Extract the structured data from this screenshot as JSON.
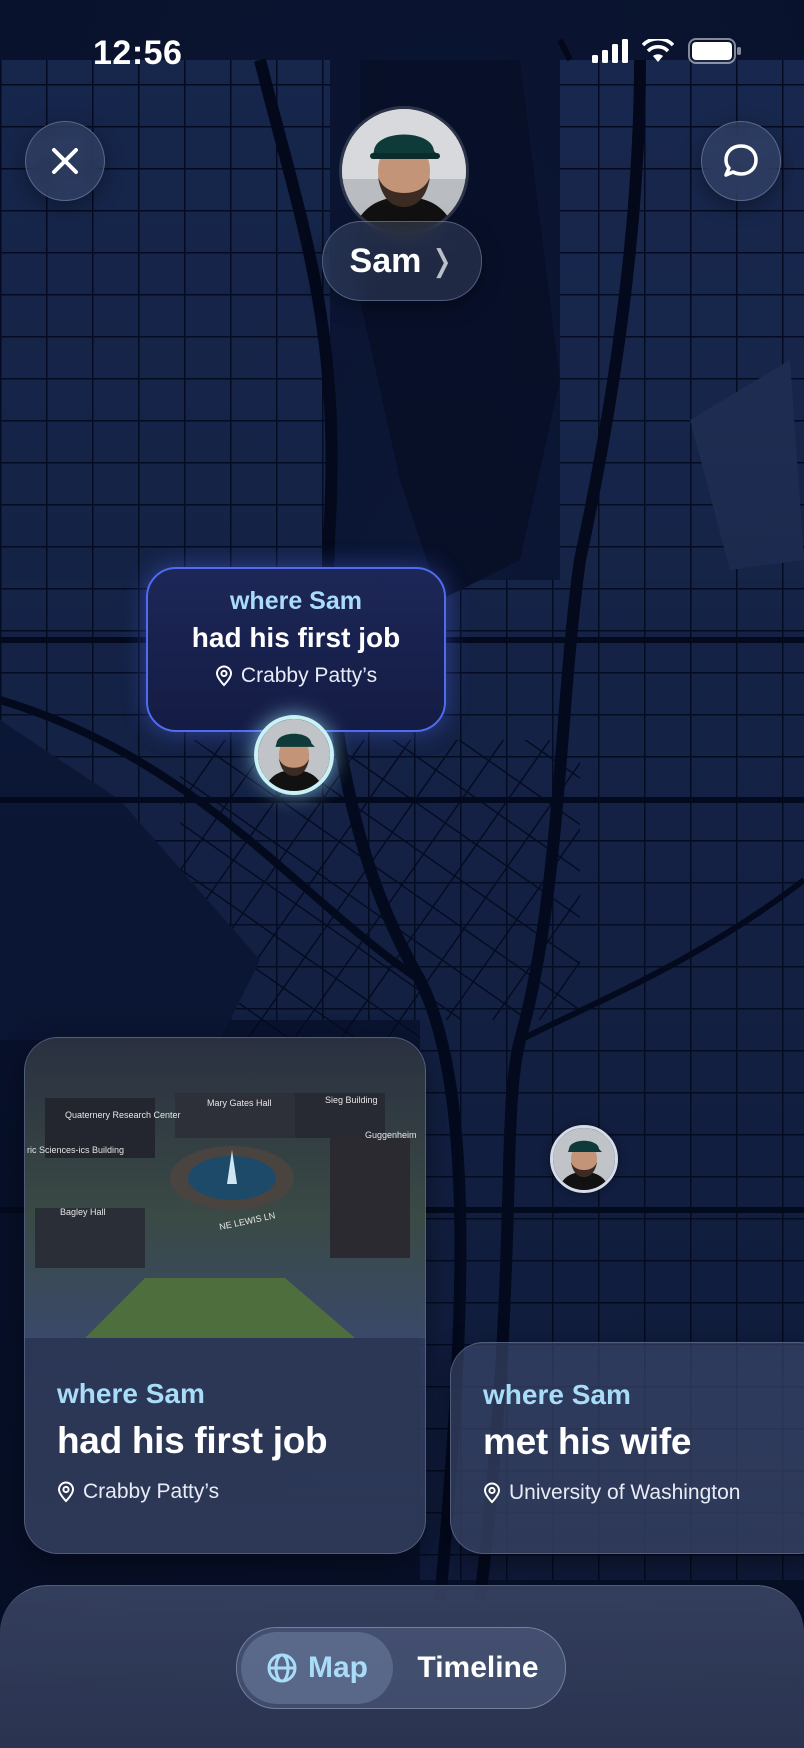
{
  "status_bar": {
    "time": "12:56",
    "icons": [
      "signal-icon",
      "wifi-icon",
      "battery-icon"
    ]
  },
  "header": {
    "close_icon": "close-icon",
    "chat_icon": "chat-bubble-icon",
    "profile_name": "Sam",
    "profile_chevron": "❭"
  },
  "map": {
    "callout": {
      "prefix": "where Sam",
      "title": "had his first job",
      "location": "Crabby Patty’s"
    }
  },
  "cards": [
    {
      "prefix": "where Sam",
      "title": "had his first job",
      "location": "Crabby Patty’s",
      "image_labels": [
        "Mary Gates Hall",
        "Sieg Building",
        "Quaternery Research Center",
        "Guggenheim",
        "Bagley Hall",
        "NE LEWIS LN",
        "ric Sciences-ics Building"
      ]
    },
    {
      "prefix": "where Sam",
      "title": "met his wife",
      "location": "University of Washington"
    }
  ],
  "bottom_nav": {
    "map_label": "Map",
    "timeline_label": "Timeline",
    "selected": "Map"
  },
  "colors": {
    "accent_text": "#a9dcf8",
    "callout_border": "#4f6bf0",
    "map_background": "#0a1430"
  }
}
